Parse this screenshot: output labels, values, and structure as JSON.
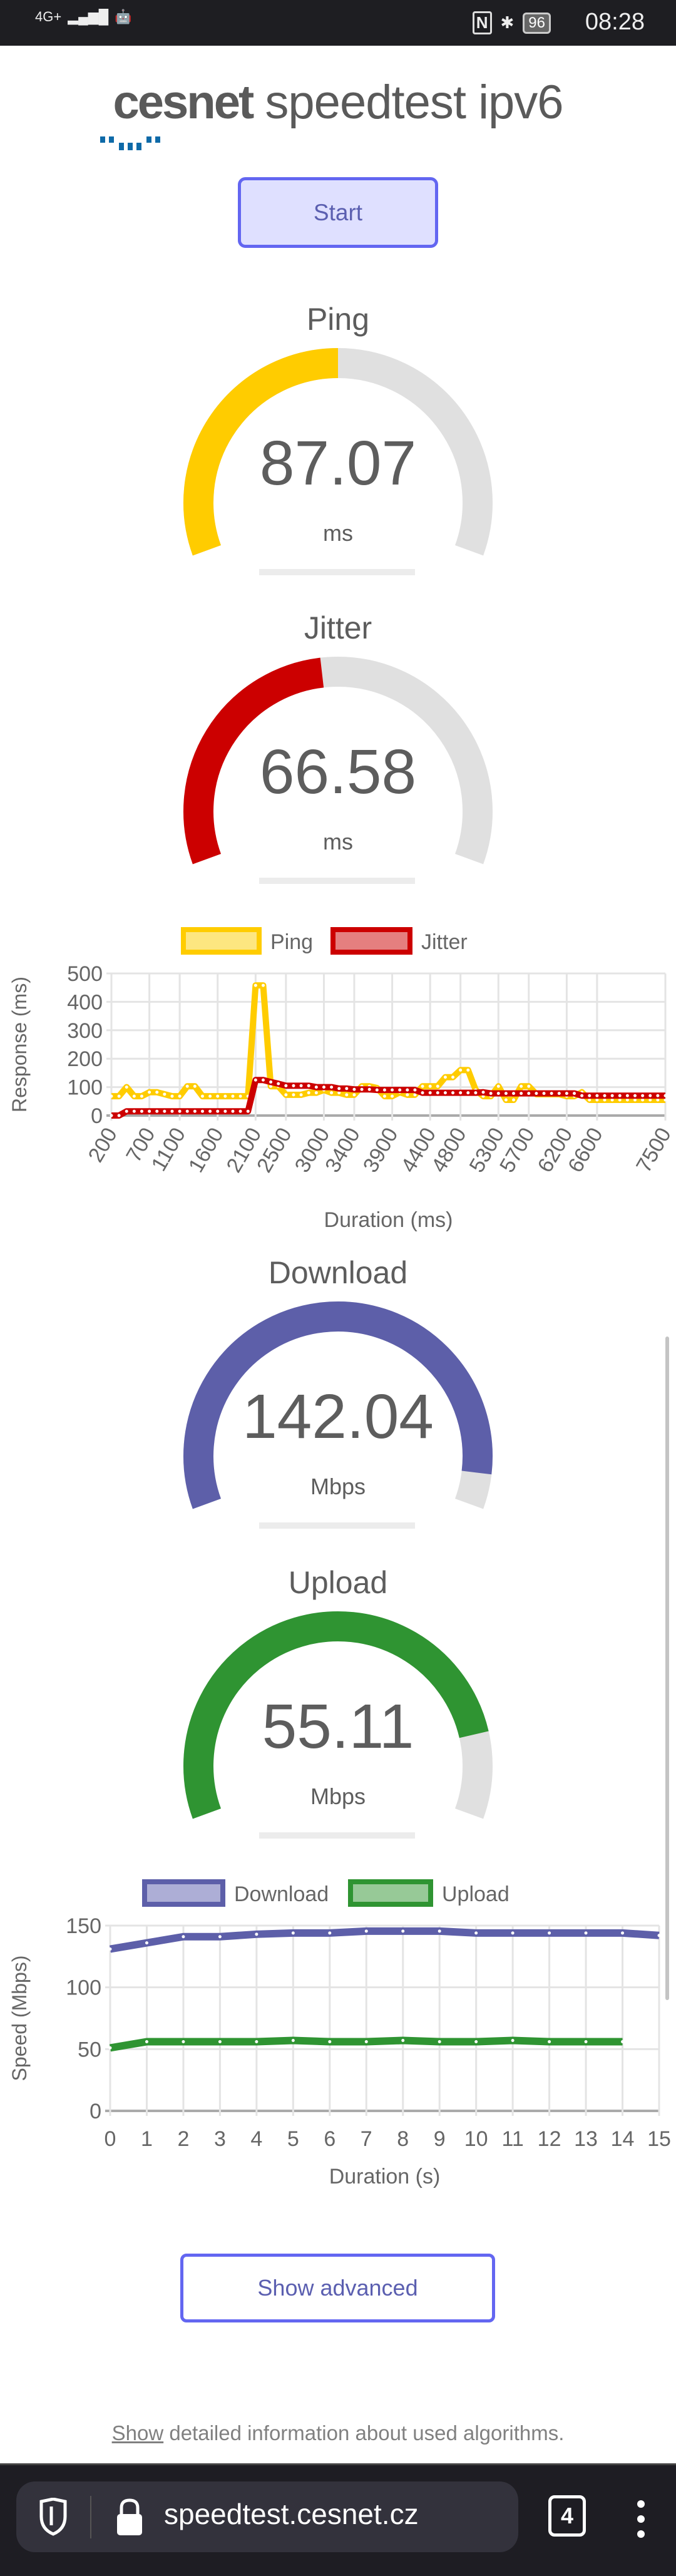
{
  "status_bar": {
    "network": "4G+",
    "battery": "96",
    "time": "08:28"
  },
  "logo": {
    "brand": "cesnet",
    "rest": "speedtest ipv6"
  },
  "start_label": "Start",
  "colors": {
    "accent": "#6366f1",
    "ping": "#ffcc00",
    "jitter": "#cc0000",
    "download": "#5d5fa9",
    "upload": "#2f9432",
    "track": "#e0e0e0"
  },
  "gauges": [
    {
      "title": "Ping",
      "value": "87.07",
      "unit": "ms",
      "fill_fraction": 0.5,
      "color": "#ffcc00"
    },
    {
      "title": "Jitter",
      "value": "66.58",
      "unit": "ms",
      "fill_fraction": 0.47,
      "color": "#cc0000"
    },
    {
      "title": "Download",
      "value": "142.04",
      "unit": "Mbps",
      "fill_fraction": 0.94,
      "color": "#5d5fa9"
    },
    {
      "title": "Upload",
      "value": "55.11",
      "unit": "Mbps",
      "fill_fraction": 0.85,
      "color": "#2f9432"
    }
  ],
  "chart_data": [
    {
      "type": "line",
      "xlabel": "Duration (ms)",
      "ylabel": "Response (ms)",
      "ylim": [
        0,
        500
      ],
      "yticks": [
        "0",
        "100",
        "200",
        "300",
        "400",
        "500"
      ],
      "xticks": [
        "200",
        "700",
        "1100",
        "1600",
        "2100",
        "2500",
        "3000",
        "3400",
        "3900",
        "4400",
        "4800",
        "5300",
        "5700",
        "6200",
        "6600",
        "7500"
      ],
      "grid": true,
      "legend": "top",
      "x": [
        200,
        300,
        400,
        500,
        600,
        700,
        800,
        900,
        1000,
        1100,
        1200,
        1300,
        1400,
        1500,
        1600,
        1700,
        1800,
        1900,
        2000,
        2100,
        2200,
        2300,
        2400,
        2500,
        2600,
        2700,
        2800,
        2900,
        3000,
        3100,
        3200,
        3300,
        3400,
        3500,
        3600,
        3700,
        3800,
        3900,
        4000,
        4100,
        4200,
        4300,
        4400,
        4500,
        4600,
        4700,
        4800,
        4900,
        5000,
        5100,
        5200,
        5300,
        5400,
        5500,
        5600,
        5700,
        5800,
        5900,
        6000,
        6100,
        6200,
        6300,
        6400,
        6500,
        6600,
        6700,
        6800,
        6900,
        7000,
        7100,
        7200,
        7300,
        7400,
        7500
      ],
      "series": [
        {
          "name": "Ping",
          "color": "#ffcc00",
          "fill": "#fde680",
          "values": [
            68,
            68,
            100,
            68,
            68,
            82,
            82,
            75,
            68,
            68,
            103,
            103,
            68,
            68,
            68,
            68,
            68,
            68,
            68,
            458,
            458,
            103,
            103,
            73,
            73,
            73,
            80,
            80,
            90,
            80,
            80,
            73,
            73,
            103,
            103,
            97,
            68,
            68,
            82,
            73,
            73,
            103,
            103,
            103,
            135,
            135,
            160,
            160,
            90,
            68,
            68,
            103,
            55,
            55,
            103,
            103,
            75,
            75,
            75,
            75,
            68,
            68,
            82,
            55,
            55,
            55,
            55,
            55,
            55,
            55,
            55,
            55,
            55,
            55
          ]
        },
        {
          "name": "Jitter",
          "color": "#cc0000",
          "fill": "#e57f7f",
          "values": [
            0,
            0,
            15,
            15,
            15,
            15,
            15,
            15,
            15,
            15,
            15,
            15,
            15,
            15,
            15,
            15,
            15,
            15,
            15,
            125,
            125,
            118,
            112,
            105,
            105,
            105,
            105,
            100,
            100,
            100,
            95,
            95,
            92,
            92,
            92,
            90,
            90,
            90,
            90,
            90,
            90,
            80,
            80,
            80,
            80,
            80,
            80,
            80,
            80,
            82,
            78,
            78,
            78,
            78,
            78,
            78,
            78,
            78,
            78,
            78,
            78,
            78,
            70,
            70,
            70,
            70,
            70,
            70,
            70,
            70,
            70,
            70,
            70,
            70
          ]
        }
      ]
    },
    {
      "type": "line",
      "xlabel": "Duration (s)",
      "ylabel": "Speed (Mbps)",
      "ylim": [
        0,
        150
      ],
      "yticks": [
        "0",
        "50",
        "100",
        "150"
      ],
      "xticks": [
        "0",
        "1",
        "2",
        "3",
        "4",
        "5",
        "6",
        "7",
        "8",
        "9",
        "10",
        "11",
        "12",
        "13",
        "14",
        "15"
      ],
      "grid": true,
      "legend": "top",
      "x": [
        0,
        1,
        2,
        3,
        4,
        5,
        6,
        7,
        8,
        9,
        10,
        11,
        12,
        13,
        14,
        15
      ],
      "series": [
        {
          "name": "Download",
          "color": "#5d5fa9",
          "fill": "#adaed6",
          "values": [
            131,
            136,
            141,
            141,
            143,
            144,
            144,
            145.5,
            145.5,
            145.5,
            144,
            144,
            144,
            144,
            144,
            142
          ]
        },
        {
          "name": "Upload",
          "color": "#2f9432",
          "fill": "#97c997",
          "values": [
            51,
            56,
            56,
            56,
            56,
            57,
            56,
            56,
            57,
            56,
            56,
            57,
            56,
            56,
            56
          ]
        }
      ]
    }
  ],
  "show_advanced_label": "Show advanced",
  "footer": {
    "link": "Show",
    "text": " detailed information about used algorithms."
  },
  "browser": {
    "url": "speedtest.cesnet.cz",
    "tab_count": "4"
  }
}
